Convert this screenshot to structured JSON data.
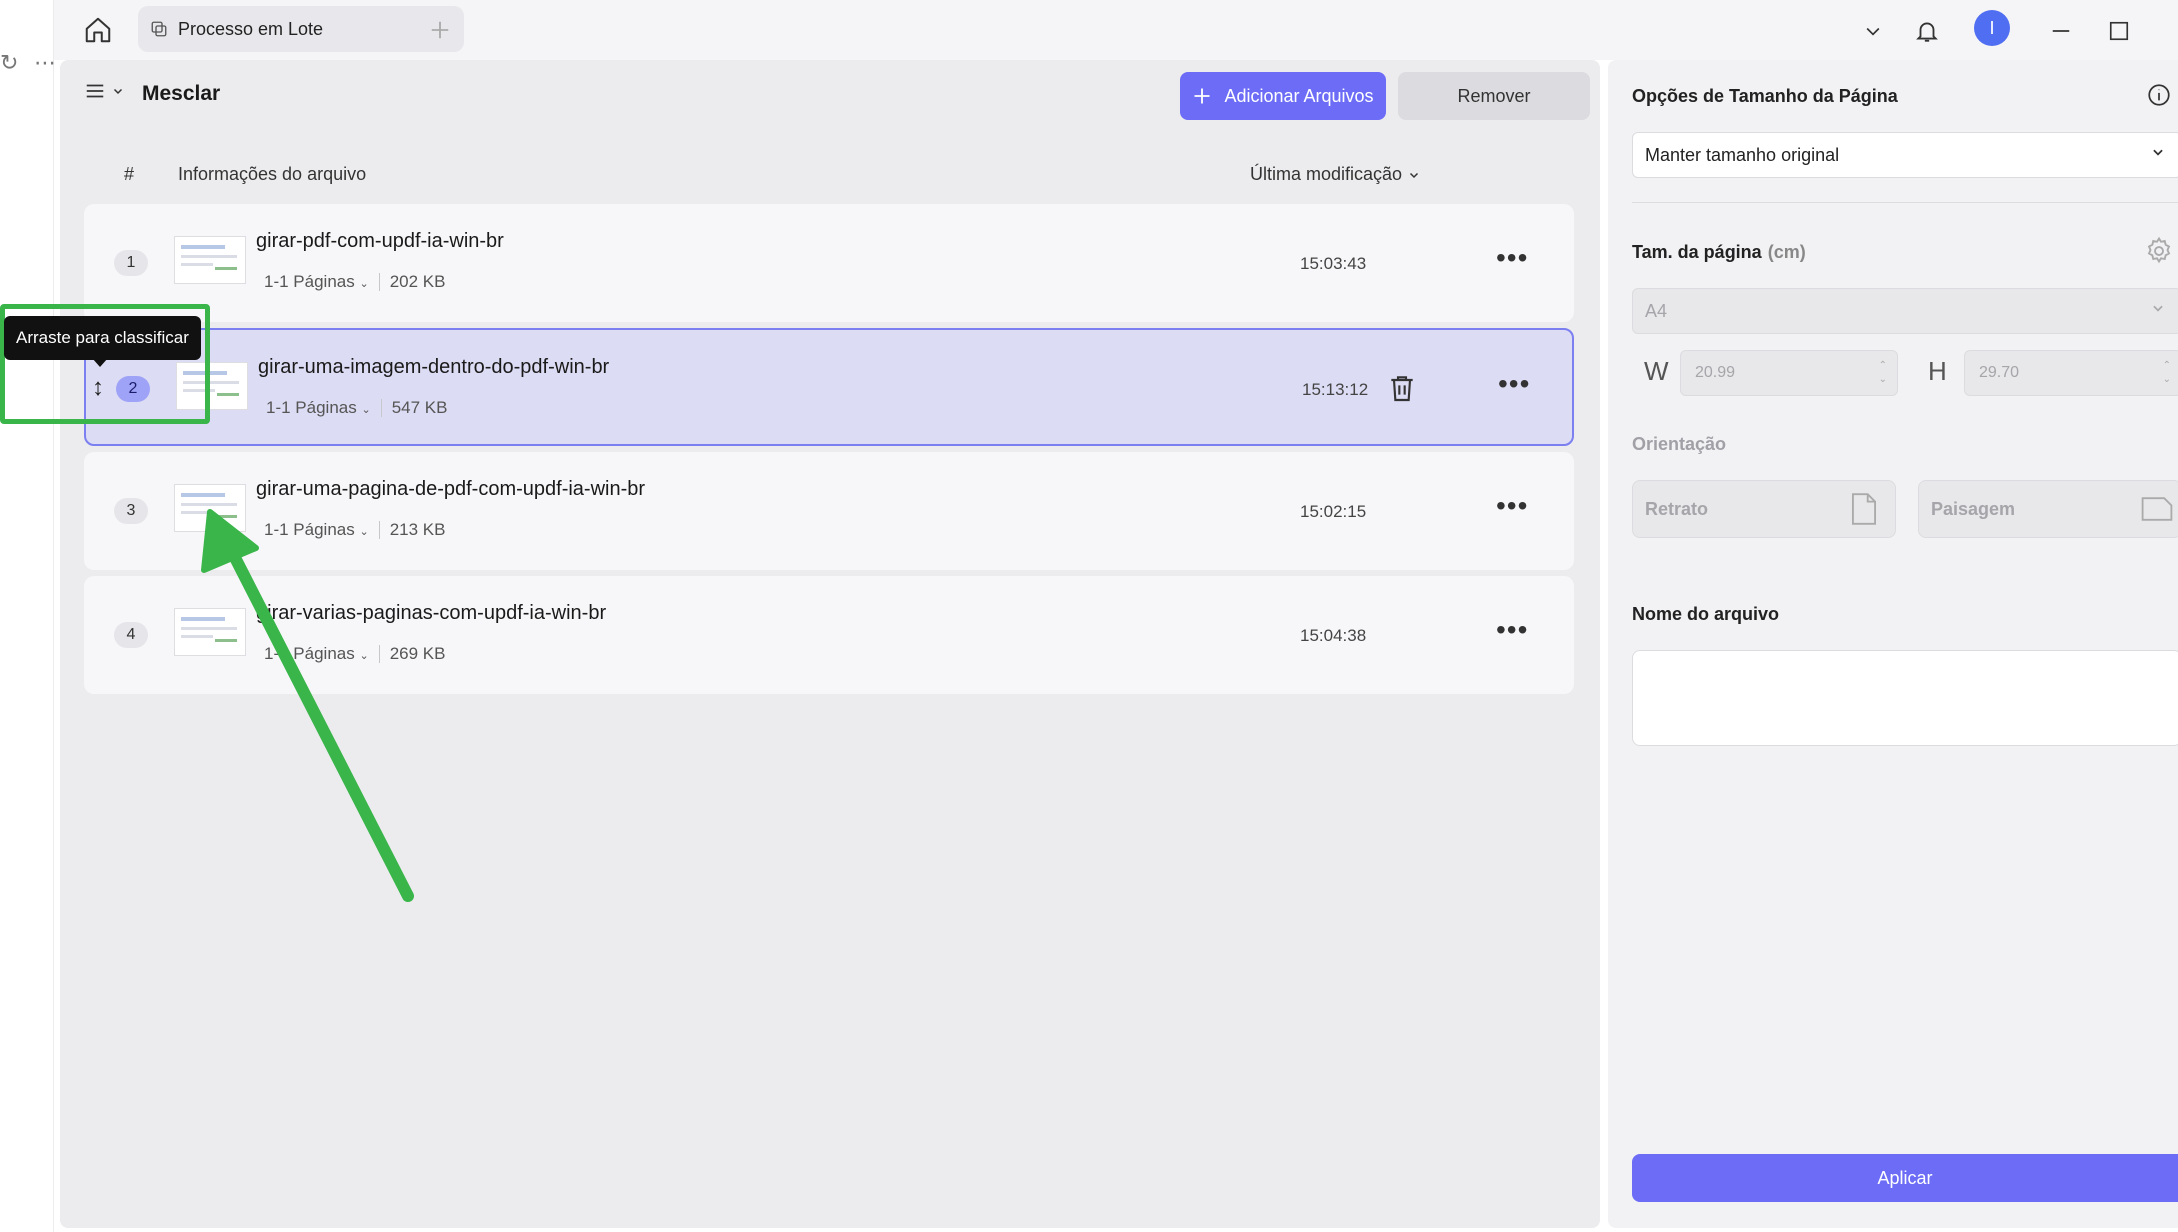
{
  "left_sliver": {
    "refresh_icon": "↻",
    "more_icon": "⋯"
  },
  "tab": {
    "label": "Processo em Lote"
  },
  "avatar": {
    "initial": "I"
  },
  "main": {
    "title": "Mesclar",
    "add_files_label": "Adicionar Arquivos",
    "remove_label": "Remover",
    "columns": {
      "number": "#",
      "file_info": "Informações do arquivo",
      "last_modified": "Última modificação"
    }
  },
  "files": [
    {
      "index": "1",
      "name": "girar-pdf-com-updf-ia-win-br",
      "pages": "1-1 Páginas",
      "size": "202 KB",
      "time": "15:03:43"
    },
    {
      "index": "2",
      "name": "girar-uma-imagem-dentro-do-pdf-win-br",
      "pages": "1-1 Páginas",
      "size": "547 KB",
      "time": "15:13:12"
    },
    {
      "index": "3",
      "name": "girar-uma-pagina-de-pdf-com-updf-ia-win-br",
      "pages": "1-1 Páginas",
      "size": "213 KB",
      "time": "15:02:15"
    },
    {
      "index": "4",
      "name": "girar-varias-paginas-com-updf-ia-win-br",
      "pages": "1-1 Páginas",
      "size": "269 KB",
      "time": "15:04:38"
    }
  ],
  "tooltip": {
    "text": "Arraste para classificar"
  },
  "right_panel": {
    "page_size_options_title": "Opções de Tamanho da Página",
    "page_size_option_value": "Manter tamanho original",
    "page_size_label": "Tam. da página",
    "page_size_unit": "(cm)",
    "paper_value": "A4",
    "width_letter": "W",
    "width_value": "20.99",
    "height_letter": "H",
    "height_value": "29.70",
    "orientation_label": "Orientação",
    "portrait_label": "Retrato",
    "landscape_label": "Paisagem",
    "filename_label": "Nome do arquivo",
    "apply_label": "Aplicar"
  },
  "colors": {
    "accent": "#6c6cf6",
    "selected_row": "#dcdcf4",
    "annotation_green": "#39b54a"
  }
}
